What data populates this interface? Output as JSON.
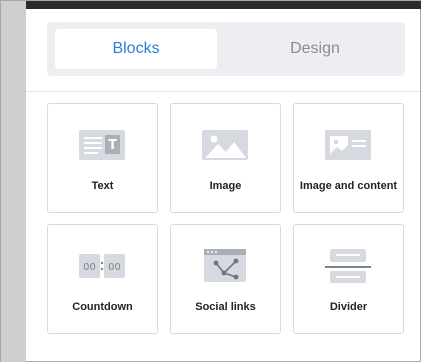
{
  "tabs": {
    "blocks": "Blocks",
    "design": "Design"
  },
  "blocks": [
    {
      "label": "Text",
      "icon": "text-block-icon"
    },
    {
      "label": "Image",
      "icon": "image-block-icon"
    },
    {
      "label": "Image and content",
      "icon": "image-and-content-block-icon"
    },
    {
      "label": "Countdown",
      "icon": "countdown-block-icon"
    },
    {
      "label": "Social links",
      "icon": "social-links-block-icon"
    },
    {
      "label": "Divider",
      "icon": "divider-block-icon"
    }
  ],
  "countdown_digits": [
    "00",
    "00"
  ],
  "text_icon_glyph": "T",
  "colors": {
    "accent": "#2a7fd6",
    "icon_fill": "#d6d9df",
    "icon_dark": "#a9aeb7"
  }
}
